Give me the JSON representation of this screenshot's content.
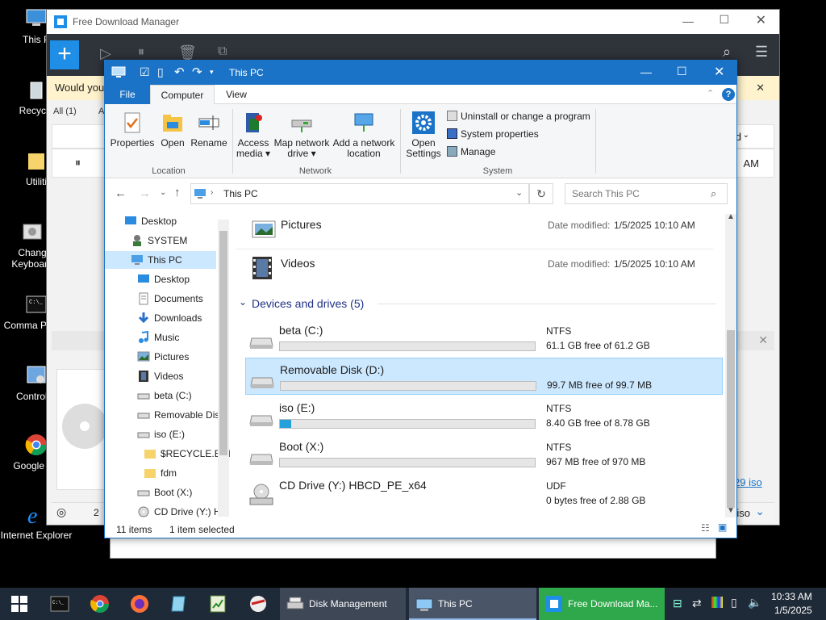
{
  "desktop": {
    "icons": [
      {
        "label": "This P",
        "icon": "computer-icon"
      },
      {
        "label": "Recycle",
        "icon": "recycle-bin-icon"
      },
      {
        "label": "Utiliti",
        "icon": "folder-icon"
      },
      {
        "label": "Chang Keyboard",
        "icon": "keyboard-settings-icon"
      },
      {
        "label": "Comma Promp",
        "icon": "command-prompt-icon"
      },
      {
        "label": "Control P",
        "icon": "control-panel-icon"
      },
      {
        "label": "Google Ch",
        "icon": "chrome-icon"
      },
      {
        "label": "Internet Explorer",
        "icon": "internet-explorer-icon"
      }
    ]
  },
  "fdm": {
    "title": "Free Download Manager",
    "notice": "Would you",
    "filter_all": "All (1)",
    "filter_next": "A",
    "col_right": "d",
    "col_right2": "AM",
    "link_text": "29 iso",
    "bottom_text": "iso",
    "status_left": "2"
  },
  "explorer": {
    "title": "This PC",
    "tabs": {
      "file": "File",
      "computer": "Computer",
      "view": "View"
    },
    "ribbon": {
      "location": {
        "group": "Location",
        "properties": "Properties",
        "open": "Open",
        "rename": "Rename"
      },
      "network": {
        "group": "Network",
        "access_media": "Access media",
        "map_drive": "Map network drive",
        "add_location": "Add a network location"
      },
      "system": {
        "group": "System",
        "open_settings": "Open Settings",
        "uninstall": "Uninstall or change a program",
        "system_properties": "System properties",
        "manage": "Manage"
      }
    },
    "address": "This PC",
    "search_placeholder": "Search This PC",
    "nav": [
      {
        "label": "Desktop",
        "icon": "desktop-icon"
      },
      {
        "label": "SYSTEM",
        "icon": "user-icon"
      },
      {
        "label": "This PC",
        "icon": "computer-icon"
      },
      {
        "label": "Desktop",
        "icon": "desktop-icon"
      },
      {
        "label": "Documents",
        "icon": "documents-icon"
      },
      {
        "label": "Downloads",
        "icon": "downloads-icon"
      },
      {
        "label": "Music",
        "icon": "music-icon"
      },
      {
        "label": "Pictures",
        "icon": "pictures-icon"
      },
      {
        "label": "Videos",
        "icon": "videos-icon"
      },
      {
        "label": "beta (C:)",
        "icon": "drive-icon"
      },
      {
        "label": "Removable Dis",
        "icon": "drive-icon"
      },
      {
        "label": "iso (E:)",
        "icon": "drive-icon"
      },
      {
        "label": "$RECYCLE.BIN",
        "icon": "folder-icon"
      },
      {
        "label": "fdm",
        "icon": "folder-icon"
      },
      {
        "label": "Boot (X:)",
        "icon": "drive-icon"
      },
      {
        "label": "CD Drive (Y:) H",
        "icon": "cd-drive-icon"
      }
    ],
    "folders": [
      {
        "name": "Pictures",
        "modified_label": "Date modified:",
        "modified": "1/5/2025 10:10 AM",
        "icon": "pictures-folder-icon"
      },
      {
        "name": "Videos",
        "modified_label": "Date modified:",
        "modified": "1/5/2025 10:10 AM",
        "icon": "videos-folder-icon"
      }
    ],
    "devices_header": "Devices and drives (5)",
    "drives": [
      {
        "name": "beta (C:)",
        "fs": "NTFS",
        "free": "61.1 GB free of 61.2 GB",
        "used_fraction": 0.002
      },
      {
        "name": "Removable Disk (D:)",
        "fs": "",
        "free": "99.7 MB free of 99.7 MB",
        "used_fraction": 0.0
      },
      {
        "name": "iso (E:)",
        "fs": "NTFS",
        "free": "8.40 GB free of 8.78 GB",
        "used_fraction": 0.043
      },
      {
        "name": "Boot (X:)",
        "fs": "NTFS",
        "free": "967 MB free of 970 MB",
        "used_fraction": 0.003
      },
      {
        "name": "CD Drive (Y:) HBCD_PE_x64",
        "fs": "UDF",
        "free": "0 bytes free of 2.88 GB",
        "used_fraction": null
      }
    ],
    "status": {
      "items": "11 items",
      "selected": "1 item selected"
    },
    "colors": {
      "accent": "#1a73c7",
      "selection": "#cce8ff",
      "drive_bar": "#26a0da"
    }
  },
  "taskbar": {
    "items": [
      {
        "label": "Disk Management",
        "icon": "disk-management-icon"
      },
      {
        "label": "This PC",
        "icon": "explorer-icon"
      },
      {
        "label": "Free Download Ma...",
        "icon": "fdm-icon"
      }
    ],
    "time": "10:33 AM",
    "date": "1/5/2025"
  }
}
